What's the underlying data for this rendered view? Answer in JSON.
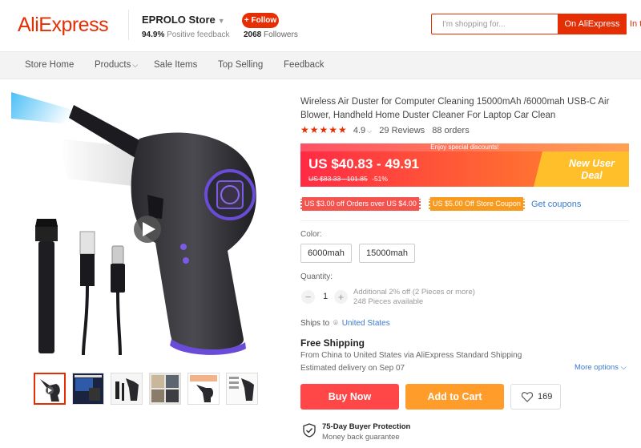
{
  "header": {
    "logo": "AliExpress",
    "store_name": "EPROLO Store",
    "feedback_pct": "94.9%",
    "feedback_label": "Positive feedback",
    "follow_label": "+ Follow",
    "followers_count": "2068",
    "followers_label": "Followers",
    "search_placeholder": "I'm shopping for...",
    "search_btn": "On AliExpress",
    "search_btn2": "In this store"
  },
  "nav": {
    "items": [
      "Store Home",
      "Products",
      "Sale Items",
      "Top Selling",
      "Feedback"
    ]
  },
  "gallery": {
    "thumb_count": 6,
    "play_icon": "play-icon"
  },
  "product": {
    "title": "Wireless Air Duster for Computer Cleaning 15000mAh /6000mah USB-C Air Blower, Handheld Home Duster Cleaner For Laptop Car Clean",
    "rating": "4.9",
    "reviews": "29 Reviews",
    "orders": "88 orders",
    "promo_strip": "Enjoy special discounts!",
    "price": "US $40.83 - 49.91",
    "old_price": "US $83.33 - 101.85",
    "discount": "-51%",
    "deal_line1": "New User",
    "deal_line2": "Deal",
    "coupon1": "US $3.00 off Orders over US $4.00",
    "coupon2": "US $5.00 Off Store Coupon",
    "get_coupons": "Get coupons",
    "color_label": "Color:",
    "options": [
      "6000mah",
      "15000mah"
    ],
    "quantity_label": "Quantity:",
    "quantity": "1",
    "qty_info1": "Additional 2% off (2 Pieces or more)",
    "qty_info2": "248 Pieces available",
    "ships_to_label": "Ships to",
    "ships_to_country": "United States",
    "free_shipping": "Free Shipping",
    "ship_from": "From China to United States via AliExpress Standard Shipping",
    "delivery": "Estimated delivery on Sep 07",
    "more_options": "More options",
    "buy_now": "Buy Now",
    "add_to_cart": "Add to Cart",
    "wishlist_count": "169",
    "protection_title": "75-Day Buyer Protection",
    "protection_sub": "Money back guarantee"
  },
  "colors": {
    "brand": "#e62e04",
    "buy": "#ff4747",
    "cart": "#ff9c2a",
    "link": "#3c79ce"
  }
}
